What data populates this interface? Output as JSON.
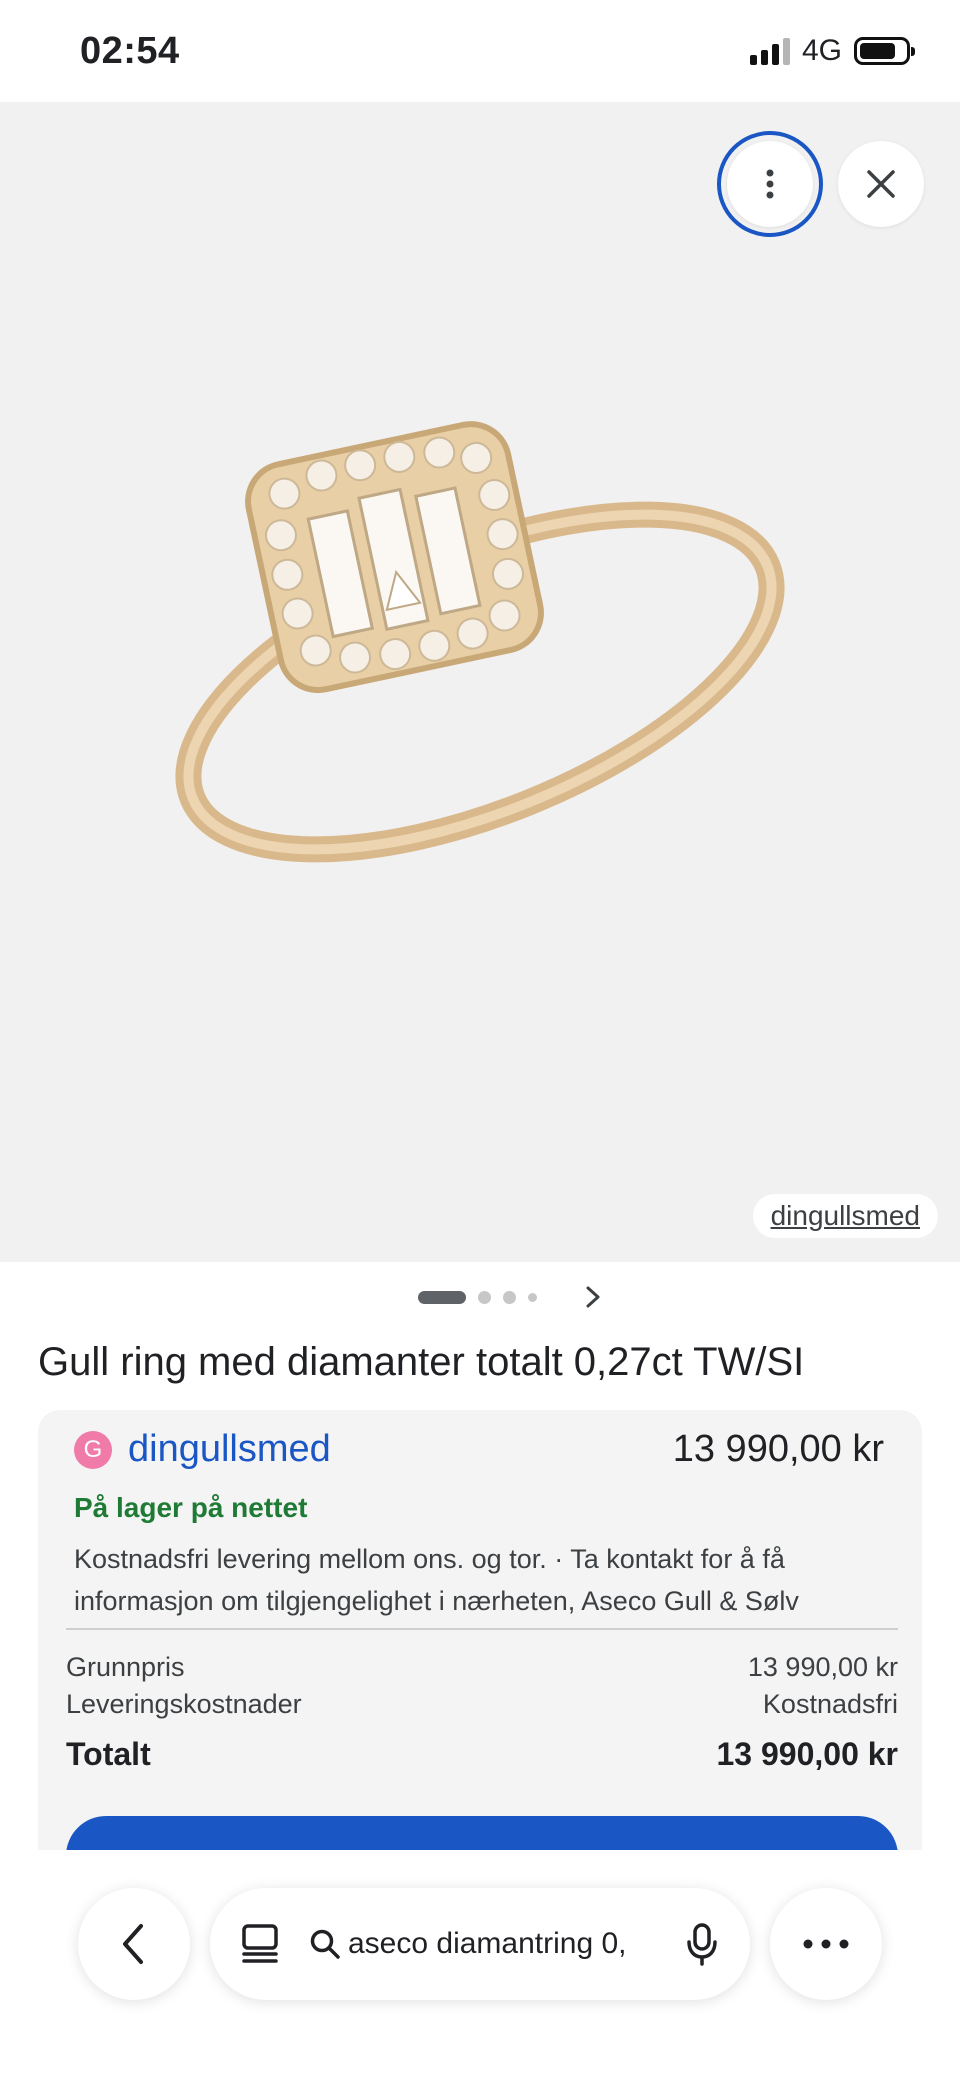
{
  "status": {
    "time": "02:54",
    "network": "4G"
  },
  "image": {
    "source_label": "dingullsmed",
    "more_icon": "more-vertical-icon",
    "close_icon": "close-icon"
  },
  "carousel": {
    "count": 4,
    "active_index": 0
  },
  "product": {
    "title": "Gull ring med diamanter totalt 0,27ct TW/SI"
  },
  "offer": {
    "merchant_initial": "G",
    "merchant_name": "dingullsmed",
    "price": "13 990,00 kr",
    "stock": "På lager på nettet",
    "description": "Kostnadsfri levering mellom ons. og tor. · Ta kontakt for å få informasjon om tilgjengelighet i nærheten, Aseco Gull & Sølv",
    "base_price_label": "Grunnpris",
    "base_price_value": "13 990,00 kr",
    "shipping_label": "Leveringskostnader",
    "shipping_value": "Kostnadsfri",
    "total_label": "Totalt",
    "total_value": "13 990,00 kr"
  },
  "toolbar": {
    "query": "aseco diamantring 0,",
    "back_icon": "chevron-left-icon",
    "tabs_icon": "tabs-icon",
    "search_icon": "search-icon",
    "mic_icon": "mic-icon",
    "more_icon": "more-horizontal-icon"
  },
  "colors": {
    "link_blue": "#1a56c4",
    "stock_green": "#1e7a34",
    "image_bg": "#f1f1f1",
    "card_bg": "#f4f4f4"
  }
}
